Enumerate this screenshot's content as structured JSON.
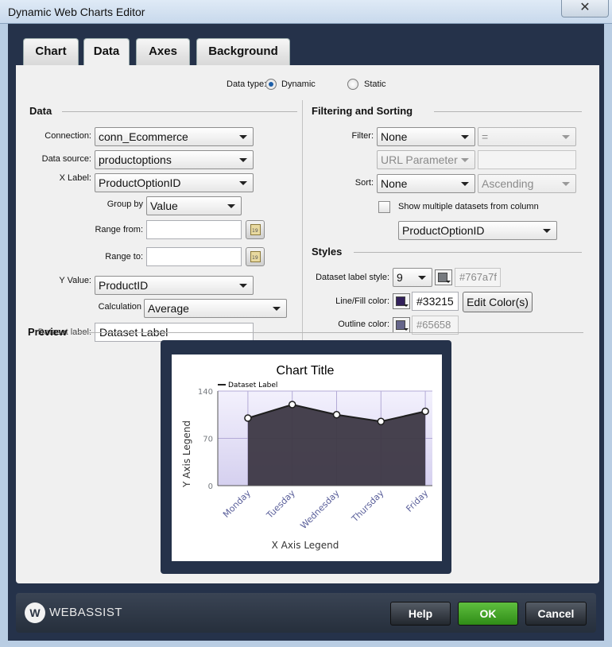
{
  "window": {
    "title": "Dynamic Web Charts Editor",
    "close_glyph": "✕"
  },
  "tabs": [
    {
      "label": "Chart",
      "active": false
    },
    {
      "label": "Data",
      "active": true
    },
    {
      "label": "Axes",
      "active": false
    },
    {
      "label": "Background",
      "active": false
    }
  ],
  "data_type": {
    "label": "Data type:",
    "options": [
      {
        "label": "Dynamic",
        "selected": true
      },
      {
        "label": "Static",
        "selected": false
      }
    ]
  },
  "data_section": {
    "title": "Data",
    "connection": {
      "label": "Connection:",
      "value": "conn_Ecommerce"
    },
    "data_source": {
      "label": "Data source:",
      "value": "productoptions"
    },
    "x_label": {
      "label": "X Label:",
      "value": "ProductOptionID"
    },
    "group_by": {
      "label": "Group by",
      "value": "Value"
    },
    "range_from": {
      "label": "Range from:",
      "value": ""
    },
    "range_to": {
      "label": "Range to:",
      "value": ""
    },
    "y_value": {
      "label": "Y Value:",
      "value": "ProductID"
    },
    "calculation": {
      "label": "Calculation",
      "value": "Average"
    },
    "dataset_label": {
      "label": "Dataset label:",
      "value": "Dataset Label"
    }
  },
  "filter_section": {
    "title": "Filtering and Sorting",
    "filter": {
      "label": "Filter:",
      "value": "None",
      "operator": "=",
      "operand": ""
    },
    "url_parameter": {
      "value": "URL Parameter",
      "text": ""
    },
    "sort": {
      "label": "Sort:",
      "value": "None",
      "direction": "Ascending"
    },
    "multiple_datasets": {
      "label": "Show multiple datasets from column",
      "checked": false,
      "column": "ProductOptionID"
    }
  },
  "styles_section": {
    "title": "Styles",
    "dataset_label_style": {
      "label": "Dataset label style:",
      "size": "9",
      "color": "#767a7f",
      "text": "#767a7f"
    },
    "line_fill": {
      "label": "Line/Fill color:",
      "color": "#33215b",
      "text": "#33215",
      "edit_button": "Edit Color(s)"
    },
    "outline": {
      "label": "Outline color:",
      "color": "#65658a",
      "text": "#65658"
    }
  },
  "preview": {
    "label": "Preview",
    "chart_data": {
      "type": "area",
      "title": "Chart Title",
      "xlabel": "X Axis Legend",
      "ylabel": "Y Axis Legend",
      "categories": [
        "Monday",
        "Tuesday",
        "Wednesday",
        "Thursday",
        "Friday"
      ],
      "series": [
        {
          "name": "Dataset Label",
          "values": [
            100,
            120,
            105,
            95,
            110
          ]
        }
      ],
      "yticks": [
        "0",
        "70",
        "140"
      ],
      "ylim": [
        0,
        140
      ],
      "grid": true,
      "legend": "top-left",
      "colors": {
        "fill": "#33215b",
        "outline": "#65658a",
        "axis_text": "#767a7f",
        "plot_bg": "#d5d0ef"
      }
    }
  },
  "footer": {
    "logo_glyph": "W",
    "logo_text": "WEBASSIST",
    "help": "Help",
    "ok": "OK",
    "cancel": "Cancel"
  }
}
